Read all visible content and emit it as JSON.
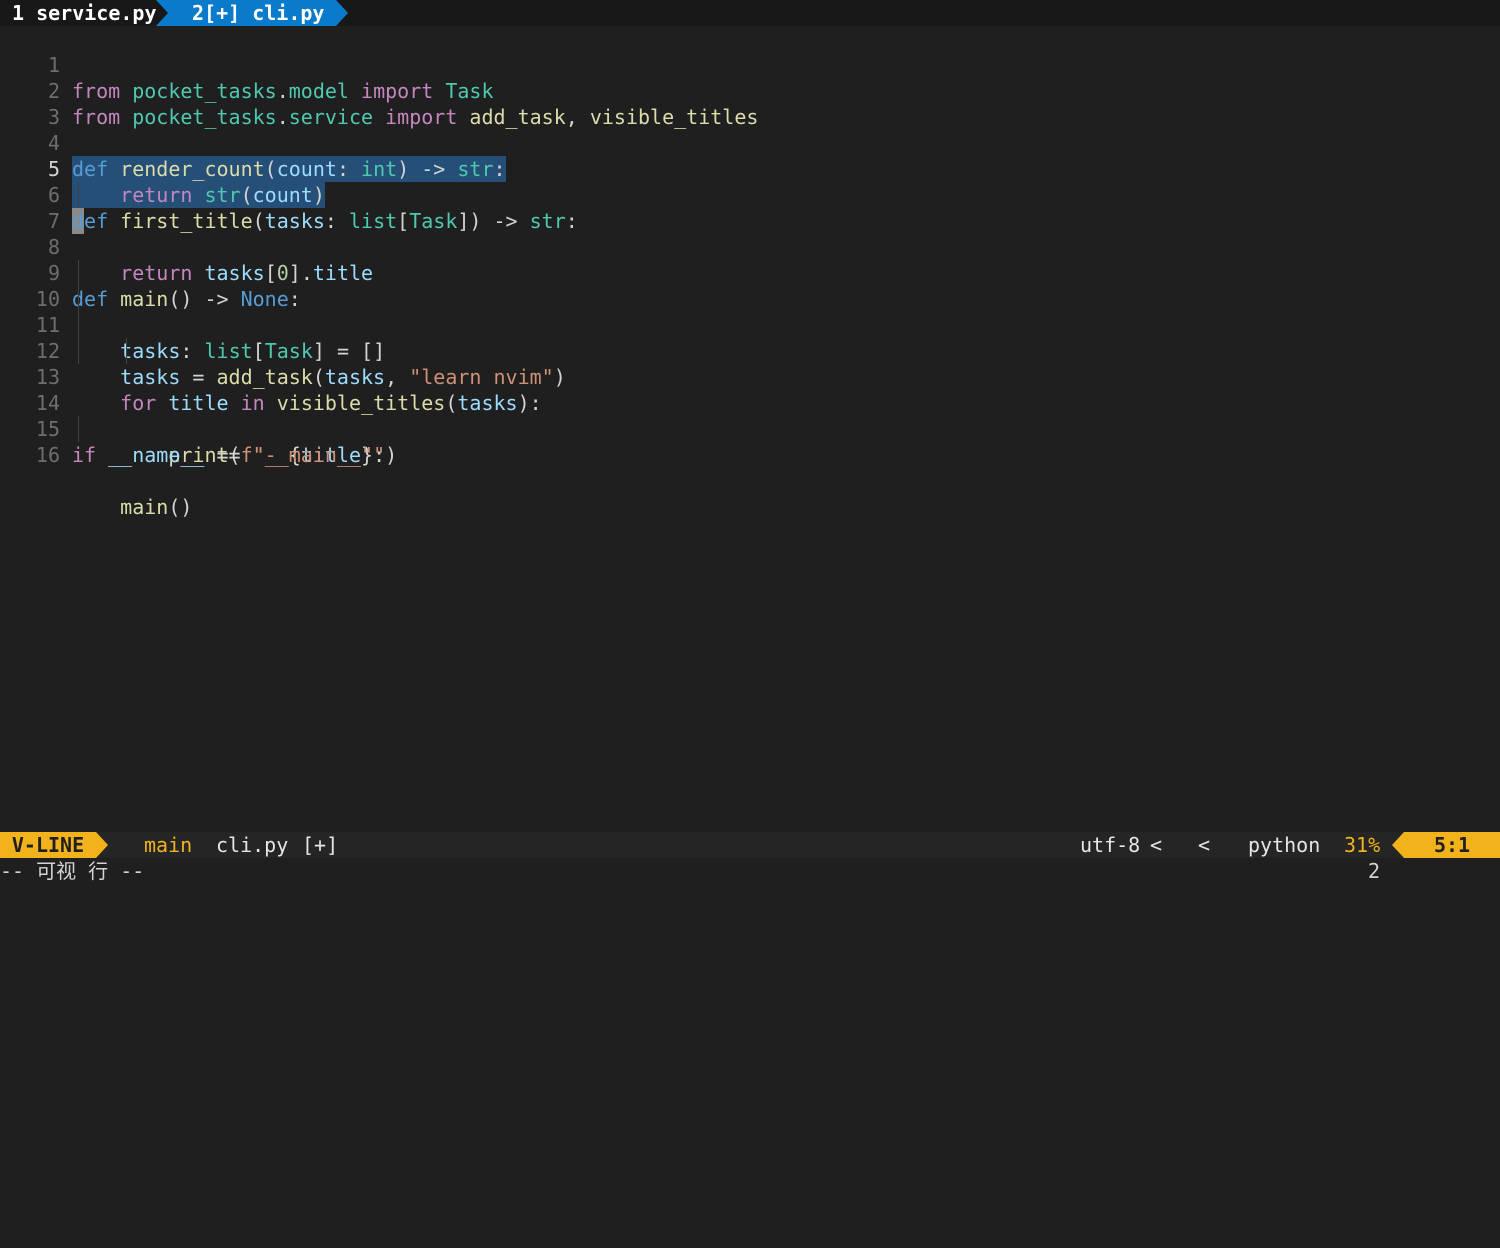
{
  "tabs": [
    {
      "label": "1 service.py",
      "active": false
    },
    {
      "label": "2[+] cli.py",
      "active": true
    }
  ],
  "editor": {
    "line_numbers": [
      "1",
      "2",
      "3",
      "4",
      "5",
      "6",
      "7",
      "8",
      "9",
      "10",
      "11",
      "12",
      "13",
      "14",
      "15",
      "16"
    ],
    "current_line": "5"
  },
  "status": {
    "mode": "V-LINE",
    "branch_icon": "git-branch-icon",
    "branch": "main",
    "filename": "cli.py",
    "modified": "[+]",
    "encoding": "utf-8",
    "separator": "<",
    "os_icon": "linux-icon",
    "filetype_icon": "python-icon",
    "filetype": "python",
    "percent": "31%",
    "position": "5:1"
  },
  "cmdline": {
    "message": "-- 可视 行 --",
    "selection_count": "2"
  },
  "colors": {
    "accent": "#f2b21b",
    "tab_active": "#0a7aca",
    "selection": "#264f78"
  }
}
